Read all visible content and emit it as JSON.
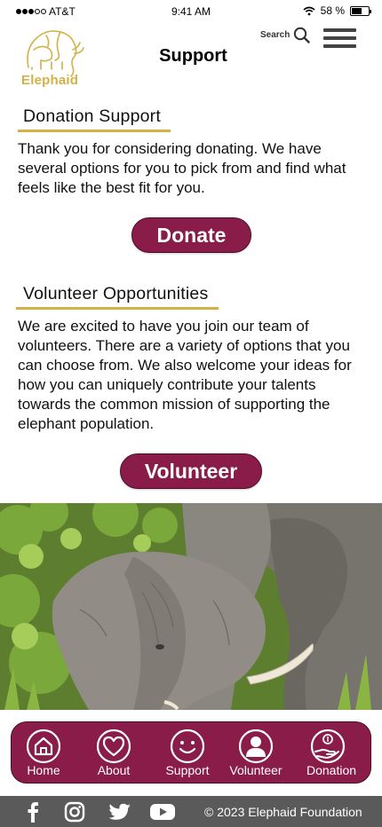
{
  "status_bar": {
    "carrier": "AT&T",
    "time": "9:41 AM",
    "battery_text": "58 %",
    "battery_level": 0.58,
    "signal_bars": 3,
    "signal_total": 5
  },
  "header": {
    "logo_text": "Elephaid",
    "title": "Support",
    "search_label": "Search"
  },
  "donation": {
    "heading": "Donation Support",
    "body": "Thank you for considering donating. We have several options for you to pick from and find what feels like the best fit for you.",
    "button": "Donate"
  },
  "volunteer": {
    "heading": "Volunteer Opportunities",
    "body": "We are excited to have you join our team of volunteers. There are a variety of options that you can choose from. We also welcome your ideas for how you can uniquely contribute your talents towards the common mission of supporting the elephant population.",
    "button": "Volunteer"
  },
  "bottom_nav": {
    "items": [
      {
        "label": "Home",
        "icon": "home-icon"
      },
      {
        "label": "About",
        "icon": "heart-icon"
      },
      {
        "label": "Support",
        "icon": "smiley-icon"
      },
      {
        "label": "Volunteer",
        "icon": "person-icon"
      },
      {
        "label": "Donation",
        "icon": "donation-hand-icon"
      }
    ]
  },
  "footer": {
    "social": [
      "facebook-icon",
      "instagram-icon",
      "twitter-icon",
      "youtube-icon"
    ],
    "copyright": "© 2023 Elephaid Foundation"
  },
  "colors": {
    "brand_maroon": "#8a1c49",
    "brand_gold": "#d4b144",
    "footer_gray": "#5a5a5a"
  }
}
